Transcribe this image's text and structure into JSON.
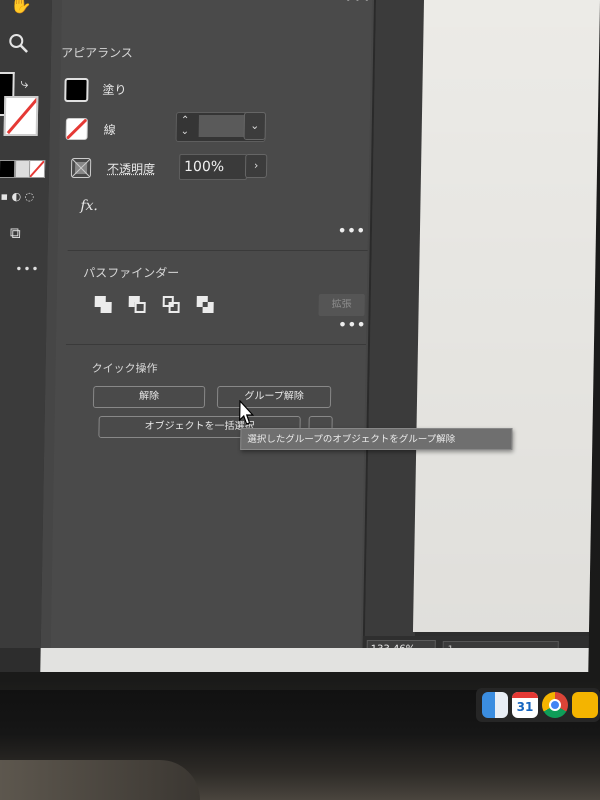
{
  "appearance": {
    "title": "アピアランス",
    "fill_label": "塗り",
    "stroke_label": "線",
    "opacity_label": "不透明度",
    "opacity_value": "100%",
    "fx_label": "fx."
  },
  "pathfinder": {
    "title": "パスファインダー",
    "expand_label": "拡張"
  },
  "quick_actions": {
    "title": "クイック操作",
    "release_label": "解除",
    "ungroup_label": "グループ解除",
    "batch_select_label": "オブジェクトを一括選択"
  },
  "tooltip": {
    "text": "選択したグループのオブジェクトをグループ解除"
  },
  "more_dots": "•••",
  "statusbar": {
    "zoom": "133.46%",
    "artboard_num": "1"
  },
  "dock": {
    "calendar_day": "31"
  },
  "colors": {
    "panel_bg": "#4a4a4a",
    "artboard": "#ecebe7",
    "stroke_none": "#e53935",
    "chrome_red": "#db4437",
    "chrome_yellow": "#f4b400",
    "chrome_green": "#0f9d58",
    "chrome_blue": "#4285f4"
  },
  "icons": [
    "search-icon",
    "rotate-icon",
    "fill-swatch-icon",
    "stroke-swatch-icon",
    "stroke-none-icon",
    "opacity-icon",
    "fx-icon",
    "unite-icon",
    "minus-front-icon",
    "intersect-icon",
    "exclude-icon",
    "cursor-icon",
    "finder-icon",
    "calendar-icon",
    "chrome-icon",
    "notes-icon"
  ]
}
